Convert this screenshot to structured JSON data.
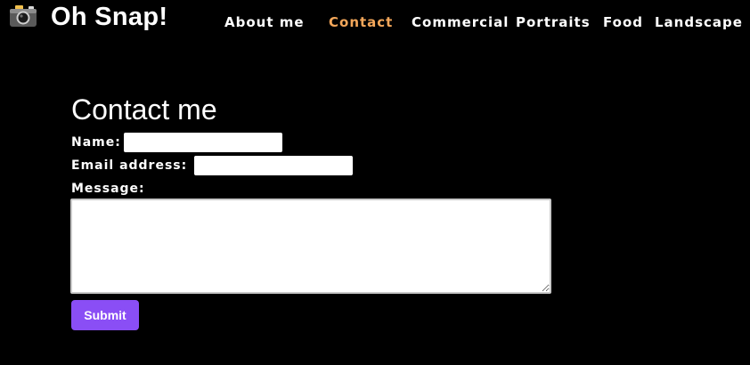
{
  "header": {
    "logo_icon": "camera-icon",
    "brand": "Oh Snap!",
    "nav": [
      {
        "label": "About me"
      },
      {
        "label": "Contact"
      },
      {
        "label": "Commercial"
      },
      {
        "label": "Portraits"
      },
      {
        "label": "Food"
      },
      {
        "label": "Landscape"
      }
    ],
    "active_nav": "Contact",
    "active_color": "#f4a75a"
  },
  "main": {
    "heading": "Contact me",
    "form": {
      "name_label": "Name:",
      "name_value": "",
      "email_label": "Email address:",
      "email_value": "",
      "message_label": "Message:",
      "message_value": "",
      "submit_label": "Submit",
      "submit_color": "#8a4ef5"
    }
  }
}
